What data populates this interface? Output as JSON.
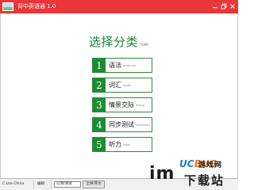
{
  "window": {
    "title": "背中英语通 1.0",
    "minimize_label": "minimize",
    "restore_label": "restore",
    "close_label": "close"
  },
  "main": {
    "heading": "选择分类",
    "heading_sub": "TOPIC"
  },
  "menu": {
    "items": [
      {
        "number": "1",
        "label": "语法",
        "sub": "grammar"
      },
      {
        "number": "2",
        "label": "词汇",
        "sub": "vocab"
      },
      {
        "number": "3",
        "label": "情景交际",
        "sub": "dialog"
      },
      {
        "number": "4",
        "label": "同步测试",
        "sub": "test/exam"
      },
      {
        "number": "5",
        "label": "听力",
        "sub": "listen"
      }
    ]
  },
  "status": {
    "cell1": "C Lite China",
    "cell2": "编辑",
    "field": "公测/测试",
    "button": "全拼/英文"
  },
  "watermark": {
    "im": "im",
    "uc_a": "UC",
    "uc_b": "BUG",
    "cn1": "游戏网",
    "cn2": "下载站"
  },
  "colors": {
    "titlebar": "#e8363a",
    "accent_green": "#1a8c32",
    "heading_green": "#17873a"
  }
}
